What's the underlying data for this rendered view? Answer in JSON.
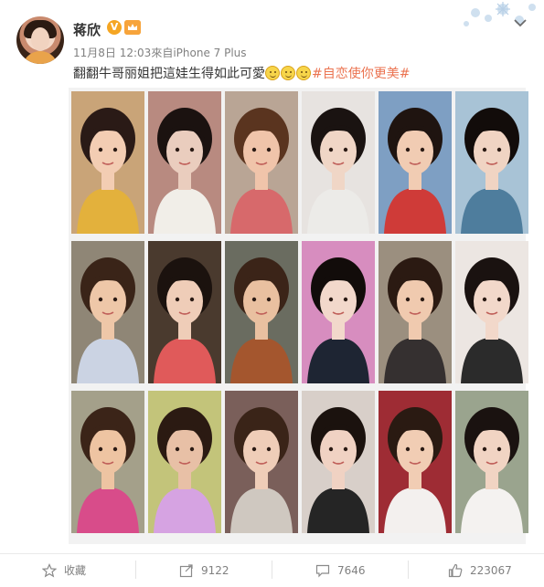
{
  "user": {
    "name": "蒋欣",
    "verified_badge": "V",
    "level_badge": "会员"
  },
  "meta": {
    "time": "11月8日 12:03",
    "source_prefix": "來自",
    "source_device": "iPhone 7 Plus"
  },
  "post": {
    "text": "翻翻牛哥丽姐把這娃生得如此可愛",
    "emoji_count": 3,
    "hashtag": "#自恋使你更美#"
  },
  "photos": [
    {
      "name": "photo-1",
      "bg": "#c9a478",
      "skin": "#f3cdb3",
      "hair": "#2a1a16",
      "cloth": "#e3b13c"
    },
    {
      "name": "photo-2",
      "bg": "#b88a80",
      "skin": "#eacdbe",
      "hair": "#1b1210",
      "cloth": "#f1eee8"
    },
    {
      "name": "photo-3",
      "bg": "#b9a595",
      "skin": "#f0c4aa",
      "hair": "#5a341f",
      "cloth": "#d7696b"
    },
    {
      "name": "photo-4",
      "bg": "#e7e3e0",
      "skin": "#f0d6c6",
      "hair": "#1a1311",
      "cloth": "#ecebe8"
    },
    {
      "name": "photo-5",
      "bg": "#7e9fc3",
      "skin": "#f1ccb3",
      "hair": "#1f1410",
      "cloth": "#cf3b38"
    },
    {
      "name": "photo-6",
      "bg": "#a8c3d6",
      "skin": "#f0d4c3",
      "hair": "#120c0a",
      "cloth": "#4e7d9d"
    },
    {
      "name": "photo-7",
      "bg": "#8f8676",
      "skin": "#eec7a8",
      "hair": "#3a2418",
      "cloth": "#cbd3e3"
    },
    {
      "name": "photo-8",
      "bg": "#4a3a2e",
      "skin": "#efcdb8",
      "hair": "#1b120e",
      "cloth": "#e05a5a"
    },
    {
      "name": "photo-9",
      "bg": "#6a6c60",
      "skin": "#e9c0a0",
      "hair": "#3b2418",
      "cloth": "#a4562e"
    },
    {
      "name": "photo-10",
      "bg": "#d78dbf",
      "skin": "#f2d8cb",
      "hair": "#120c0a",
      "cloth": "#1e2533"
    },
    {
      "name": "photo-11",
      "bg": "#9b8f7f",
      "skin": "#f0caaf",
      "hair": "#2b1a12",
      "cloth": "#353030"
    },
    {
      "name": "photo-12",
      "bg": "#ece6e2",
      "skin": "#f2d8ca",
      "hair": "#1a1210",
      "cloth": "#2b2b2b"
    },
    {
      "name": "photo-13",
      "bg": "#a4a08a",
      "skin": "#eec4a2",
      "hair": "#3b2418",
      "cloth": "#d84c8a"
    },
    {
      "name": "photo-14",
      "bg": "#c3c47a",
      "skin": "#e8c0a6",
      "hair": "#2b1a12",
      "cloth": "#d6a3e2"
    },
    {
      "name": "photo-15",
      "bg": "#7a5f5a",
      "skin": "#efcdb8",
      "hair": "#3a2418",
      "cloth": "#cfc8c0"
    },
    {
      "name": "photo-16",
      "bg": "#d8cfc9",
      "skin": "#f0d2c3",
      "hair": "#1b120e",
      "cloth": "#252525"
    },
    {
      "name": "photo-17",
      "bg": "#9e2c34",
      "skin": "#f1cdb4",
      "hair": "#2a1a12",
      "cloth": "#f3f0ee"
    },
    {
      "name": "photo-18",
      "bg": "#9aa48e",
      "skin": "#f1d4c3",
      "hair": "#1a1210",
      "cloth": "#f4f2f0"
    }
  ],
  "actions": {
    "favorite_label": "收藏",
    "repost_count": "9122",
    "comment_count": "7646",
    "like_count": "223067"
  },
  "colors": {
    "hashtag": "#eb7350",
    "meta": "#808080",
    "badge_orange": "#f5a623"
  }
}
